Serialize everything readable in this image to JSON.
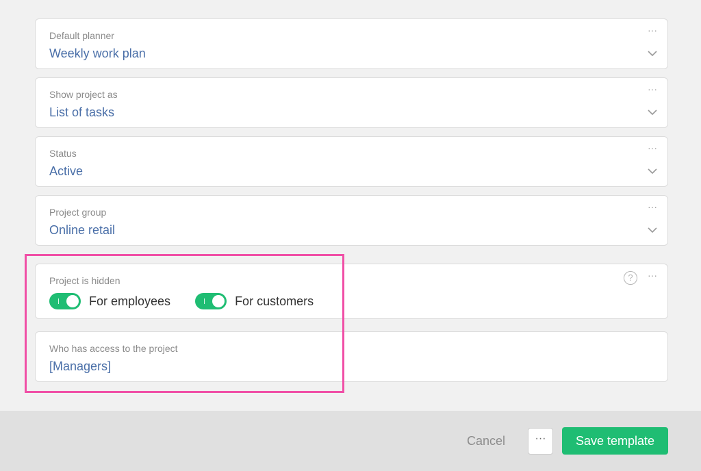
{
  "fields": {
    "default_planner": {
      "label": "Default planner",
      "value": "Weekly work plan"
    },
    "show_project_as": {
      "label": "Show project as",
      "value": "List of tasks"
    },
    "status": {
      "label": "Status",
      "value": "Active"
    },
    "project_group": {
      "label": "Project group",
      "value": "Online retail"
    },
    "project_hidden": {
      "label": "Project is hidden",
      "toggles": [
        {
          "label": "For employees",
          "on": true
        },
        {
          "label": "For customers",
          "on": true
        }
      ]
    },
    "access": {
      "label": "Who has access to the project",
      "value": "[Managers]"
    }
  },
  "icons": {
    "more": "more-dots-icon",
    "chevron": "chevron-down-icon",
    "help": "help-circle-icon",
    "help_glyph": "?",
    "more_glyph": "···"
  },
  "footer": {
    "cancel_label": "Cancel",
    "more_glyph": "···",
    "save_label": "Save template"
  },
  "colors": {
    "accent_green": "#1fbd73",
    "value_blue": "#4a6fa8",
    "highlight_pink": "#f04fa6"
  }
}
